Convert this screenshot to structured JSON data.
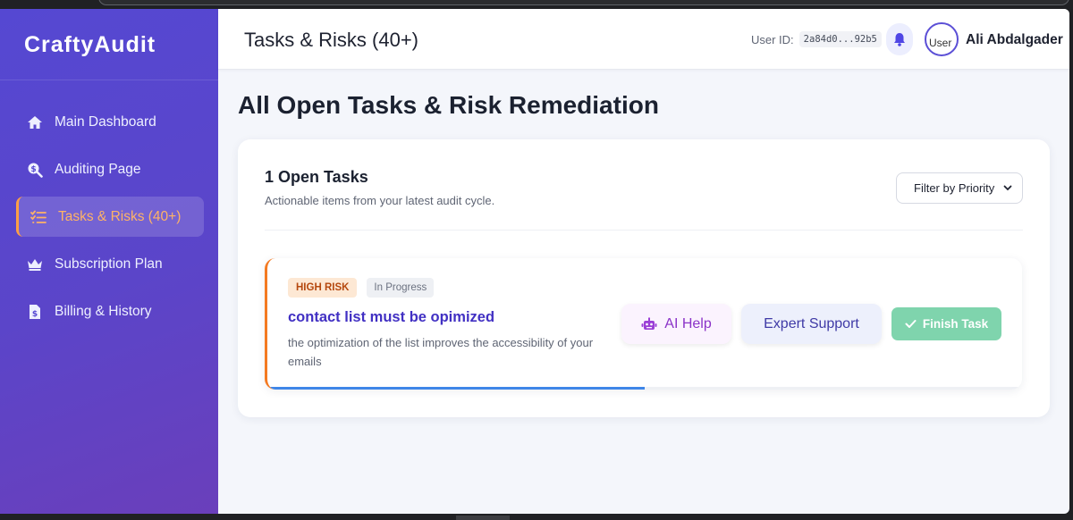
{
  "app": {
    "brand": "CraftyAudit"
  },
  "sidebar": {
    "items": [
      {
        "label": "Main Dashboard",
        "icon": "home-icon",
        "active": false
      },
      {
        "label": "Auditing Page",
        "icon": "search-dollar-icon",
        "active": false
      },
      {
        "label": "Tasks & Risks (40+)",
        "icon": "task-list-icon",
        "active": true
      },
      {
        "label": "Subscription Plan",
        "icon": "crown-icon",
        "active": false
      },
      {
        "label": "Billing & History",
        "icon": "invoice-icon",
        "active": false
      }
    ]
  },
  "header": {
    "title": "Tasks & Risks (40+)",
    "user_id_label": "User ID:",
    "user_id_value": "2a84d0...92b5",
    "avatar_alt": "User",
    "user_name": "Ali Abdalgader"
  },
  "main": {
    "page_title": "All Open Tasks & Risk Remediation",
    "panel_title": "1 Open Tasks",
    "panel_subtitle": "Actionable items from your latest audit cycle.",
    "filter_selected": "Filter by Priority"
  },
  "task": {
    "risk_badge": "HIGH RISK",
    "status_badge": "In Progress",
    "title": "contact list must be opimized",
    "description": "the optimization of the list improves the accessibility of your emails",
    "ai_help_label": "AI Help",
    "expert_support_label": "Expert Support",
    "finish_label": "Finish Task",
    "progress": 0.5
  },
  "colors": {
    "accent": "#5548d2",
    "active_nav": "#ffb366",
    "risk_border": "#f47a22",
    "progress": "#3f86e8",
    "finish_button": "#7fd4ad"
  }
}
